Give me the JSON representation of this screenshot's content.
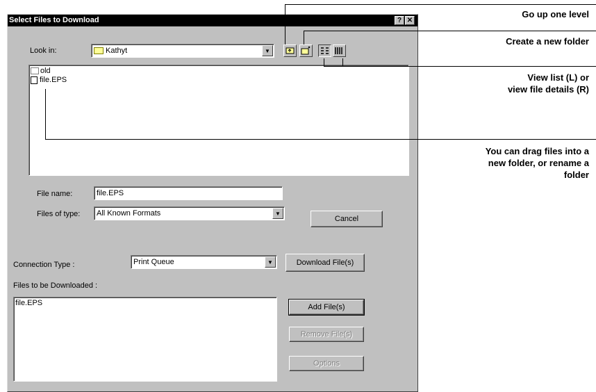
{
  "dialog": {
    "title": "Select Files to Download",
    "help_glyph": "?",
    "close_glyph": "✕",
    "look_in_label": "Look in:",
    "look_in_value": "Kathyt",
    "dropdown_arrow": "▼",
    "file_list": [
      {
        "name": "old",
        "icon": "folder-icon"
      },
      {
        "name": "file.EPS",
        "icon": "file-icon"
      }
    ],
    "file_name_label": "File name:",
    "file_name_value": "file.EPS",
    "files_of_type_label": "Files of type:",
    "files_of_type_value": "All Known Formats",
    "cancel_label": "Cancel",
    "connection_type_label": "Connection Type :",
    "connection_type_value": "Print Queue",
    "download_label": "Download File(s)",
    "files_to_download_label": "Files to be Downloaded :",
    "download_list": [
      "file.EPS"
    ],
    "add_label": "Add File(s)",
    "remove_label": "Remove File(s)",
    "options_label": "Options"
  },
  "annotations": {
    "up_level": "Go up one level",
    "new_folder": "Create a new folder",
    "view_line1": "View list (L) or",
    "view_line2": "view file details (R)",
    "drag_line1": "You can drag files into a",
    "drag_line2": "new folder, or rename a",
    "drag_line3": "folder"
  }
}
